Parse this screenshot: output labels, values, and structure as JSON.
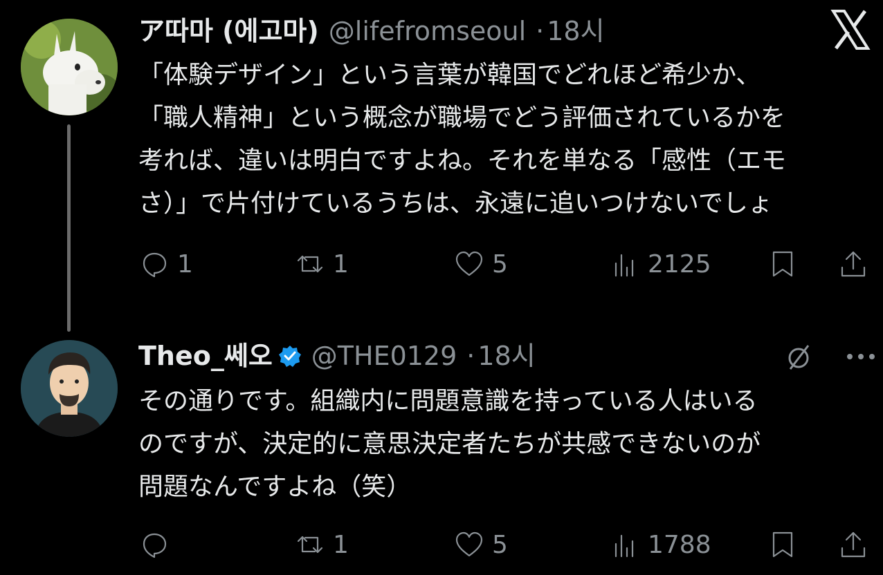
{
  "tweets": [
    {
      "author_name": "ア따마 (에고마)",
      "handle": "@lifefromseoul",
      "separator": "·",
      "time": "18시",
      "lines": [
        "「体験デザイン」という言葉が韓国でどれほど希少か、",
        "「職人精神」という概念が職場でどう評価されているかを",
        "考れば、違いは明白ですよね。それを単なる「感性（エモ",
        "さ）」で片付けているうちは、永遠に追いつけないでしょ"
      ],
      "replies": "1",
      "retweets": "1",
      "likes": "5",
      "views": "2125"
    },
    {
      "author_name": "Theo_쎄오",
      "handle": "@THE0129",
      "separator": "·",
      "time": "18시",
      "lines": [
        "その通りです。組織内に問題意識を持っている人はいる",
        "のですが、決定的に意思決定者たちが共感できないのが",
        "問題なんですよね（笑）"
      ],
      "replies": "",
      "retweets": "1",
      "likes": "5",
      "views": "1788"
    }
  ],
  "icons": {
    "platform": "x-logo-icon",
    "reply": "reply-icon",
    "retweet": "retweet-icon",
    "like": "heart-icon",
    "views": "views-icon",
    "bookmark": "bookmark-icon",
    "share": "share-icon",
    "grok": "grok-icon",
    "more": "more-icon",
    "verified": "verified-badge-icon"
  },
  "colors": {
    "background": "#000000",
    "text": "#e7e9ea",
    "muted": "#8b9196",
    "verified": "#1d9bf0"
  }
}
